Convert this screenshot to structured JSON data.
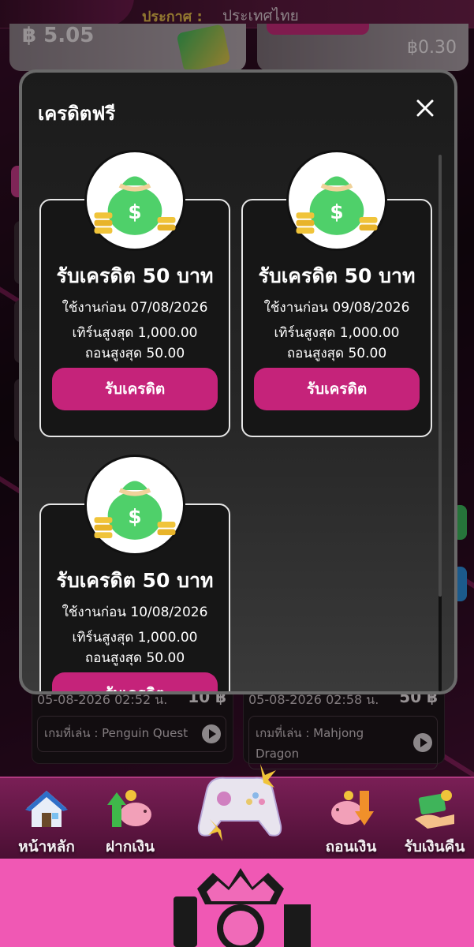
{
  "announcement": {
    "label": "ประกาศ :",
    "text": "ประเทศไทย"
  },
  "wallet": {
    "balance": "฿ 5.05",
    "secondary_balance": "฿0.30"
  },
  "modal": {
    "title": "เครดิตฟรี",
    "cards": [
      {
        "title": "รับเครดิต 50 บาท",
        "expiry": "ใช้งานก่อน 07/08/2026",
        "max_turnover": "เทิร์นสูงสุด 1,000.00",
        "max_withdraw": "ถอนสูงสุด 50.00",
        "button": "รับเครดิต"
      },
      {
        "title": "รับเครดิต 50 บาท",
        "expiry": "ใช้งานก่อน 09/08/2026",
        "max_turnover": "เทิร์นสูงสุด 1,000.00",
        "max_withdraw": "ถอนสูงสุด 50.00",
        "button": "รับเครดิต"
      },
      {
        "title": "รับเครดิต 50 บาท",
        "expiry": "ใช้งานก่อน 10/08/2026",
        "max_turnover": "เทิร์นสูงสุด 1,000.00",
        "max_withdraw": "ถอนสูงสุด 50.00",
        "button": "รับเครดิต"
      }
    ]
  },
  "history": [
    {
      "date": "05-08-2026 02:52 น.",
      "amount": "10 ฿",
      "game": "เกมที่เล่น : Penguin Quest"
    },
    {
      "date": "05-08-2026 02:58 น.",
      "amount": "50 ฿",
      "game": "เกมที่เล่น : Mahjong Dragon"
    }
  ],
  "bottom_nav": {
    "home": "หน้าหลัก",
    "deposit": "ฝากเงิน",
    "withdraw": "ถอนเงิน",
    "cashback": "รับเงินคืน"
  },
  "colors": {
    "accent": "#c5237a",
    "footer": "#f058b4"
  }
}
